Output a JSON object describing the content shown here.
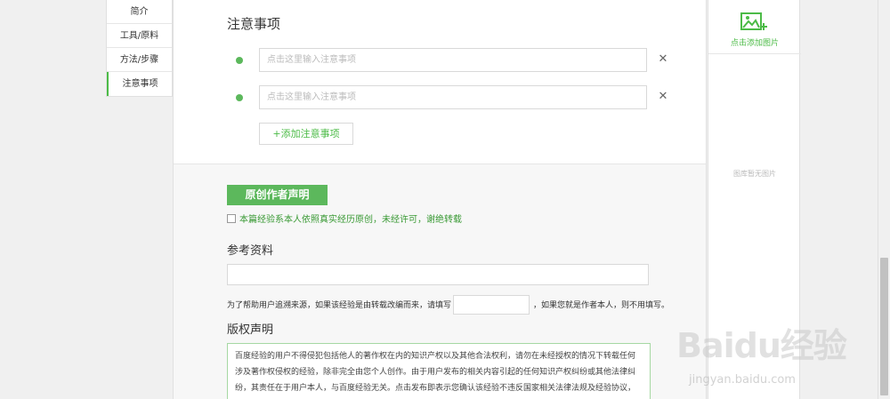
{
  "nav": {
    "items": [
      {
        "label": "简介"
      },
      {
        "label": "工具/原料"
      },
      {
        "label": "方法/步骤"
      },
      {
        "label": "注意事项"
      }
    ]
  },
  "notes": {
    "title": "注意事项",
    "placeholder": "点击这里输入注意事项",
    "close_glyph": "✕",
    "add_label": "+添加注意事项"
  },
  "original": {
    "badge": "原创作者声明",
    "checkbox_label": "本篇经验系本人依照真实经历原创，未经许可，谢绝转载"
  },
  "references": {
    "title": "参考资料",
    "source_pre": "为了帮助用户追溯来源，如果该经验是由转载改编而来，请填写",
    "source_post": "，如果您就是作者本人，则不用填写。"
  },
  "copyright": {
    "title": "版权声明",
    "text": "百度经验的用户不得侵犯包括他人的著作权在内的知识产权以及其他合法权利，请勿在未经授权的情况下转载任何涉及著作权侵权的经验，除非完全由您个人创作。由于用户发布的相关内容引起的任何知识产权纠纷或其他法律纠纷，其责任在于用户本人，与百度经验无关。点击发布即表示您确认该经验不违反国家相关法律法规及经验协议，并且您拥有该经验的全部版权。"
  },
  "image_panel": {
    "add_label": "点击添加图片",
    "empty_label": "图库暂无图片"
  },
  "watermark": {
    "brand": "Baidu经验",
    "url": "jingyan.baidu.com"
  },
  "colors": {
    "accent": "#4cbb47",
    "badge": "#5cb85c"
  }
}
